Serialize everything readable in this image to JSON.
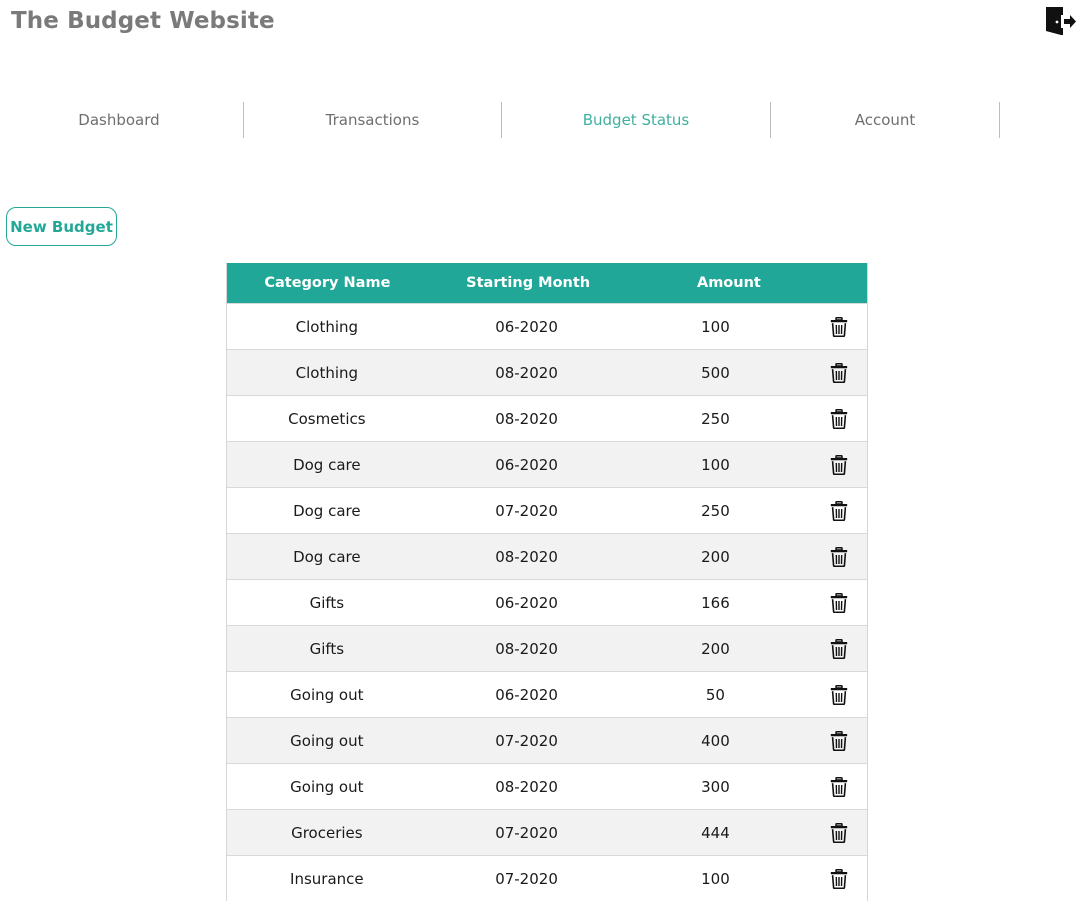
{
  "header": {
    "title": "The Budget Website",
    "logout_icon": "logout-door-icon"
  },
  "nav": {
    "tabs": [
      {
        "label": "Dashboard",
        "active": false
      },
      {
        "label": "Transactions",
        "active": false
      },
      {
        "label": "Budget Status",
        "active": true
      },
      {
        "label": "Account",
        "active": false
      }
    ]
  },
  "actions": {
    "new_budget_label": "New Budget"
  },
  "table": {
    "columns": [
      "Category Name",
      "Starting Month",
      "Amount"
    ],
    "delete_icon": "trash-icon",
    "rows": [
      {
        "category": "Clothing",
        "month": "06-2020",
        "amount": "100"
      },
      {
        "category": "Clothing",
        "month": "08-2020",
        "amount": "500"
      },
      {
        "category": "Cosmetics",
        "month": "08-2020",
        "amount": "250"
      },
      {
        "category": "Dog care",
        "month": "06-2020",
        "amount": "100"
      },
      {
        "category": "Dog care",
        "month": "07-2020",
        "amount": "250"
      },
      {
        "category": "Dog care",
        "month": "08-2020",
        "amount": "200"
      },
      {
        "category": "Gifts",
        "month": "06-2020",
        "amount": "166"
      },
      {
        "category": "Gifts",
        "month": "08-2020",
        "amount": "200"
      },
      {
        "category": "Going out",
        "month": "06-2020",
        "amount": "50"
      },
      {
        "category": "Going out",
        "month": "07-2020",
        "amount": "400"
      },
      {
        "category": "Going out",
        "month": "08-2020",
        "amount": "300"
      },
      {
        "category": "Groceries",
        "month": "07-2020",
        "amount": "444"
      },
      {
        "category": "Insurance",
        "month": "07-2020",
        "amount": "100"
      }
    ]
  },
  "colors": {
    "accent": "#21a797",
    "active_tab": "#3fb0a0",
    "title": "#7a7a7a",
    "row_alt": "#f2f2f2"
  }
}
